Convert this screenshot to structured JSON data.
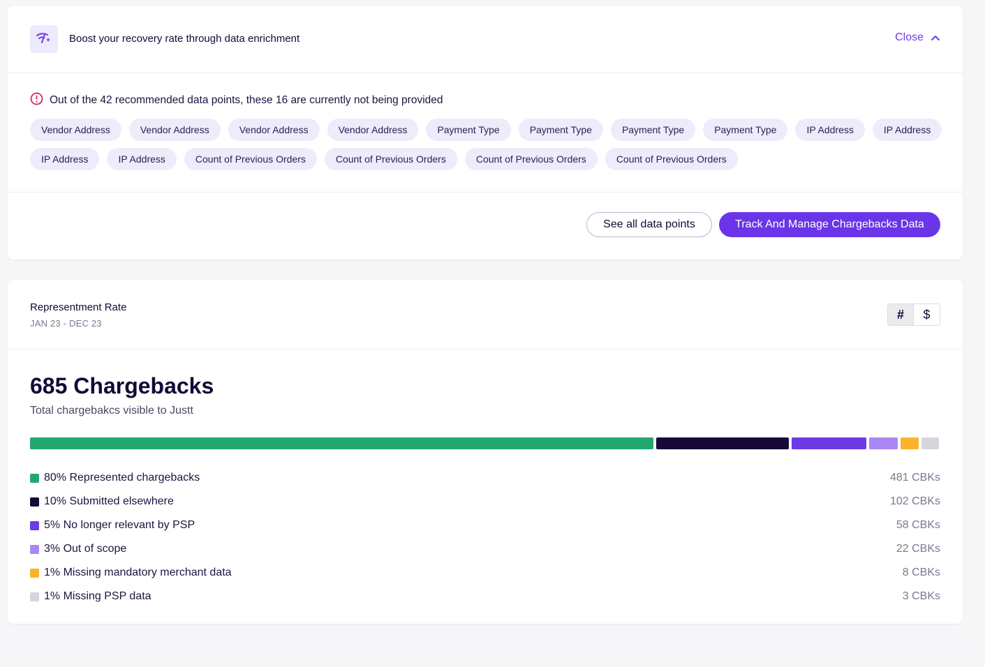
{
  "enrichment": {
    "title": "Boost your recovery rate through data enrichment",
    "close_label": "Close",
    "alert_text": "Out of the 42 recommended data points, these 16 are currently not being provided",
    "chips": [
      "Vendor Address",
      "Vendor Address",
      "Vendor Address",
      "Vendor Address",
      "Payment Type",
      "Payment Type",
      "Payment Type",
      "Payment Type",
      "IP Address",
      "IP Address",
      "IP Address",
      "IP Address",
      "Count of Previous Orders",
      "Count of Previous Orders",
      "Count of Previous Orders",
      "Count of Previous Orders"
    ],
    "see_all_label": "See all data points",
    "track_label": "Track And Manage Chargebacks Data"
  },
  "rate": {
    "title": "Representment Rate",
    "period": "JAN 23 - DEC 23",
    "toggle": {
      "count_label": "#",
      "amount_label": "$",
      "active": "count"
    },
    "total_label": "685 Chargebacks",
    "total_sub": "Total chargebakcs visible to Justt",
    "breakdown": [
      {
        "label": "80% Represented chargebacks",
        "count": "481 CBKs",
        "value": 481,
        "color": "#22a86e"
      },
      {
        "label": "10% Submitted elsewhere",
        "count": "102 CBKs",
        "value": 102,
        "color": "#16093a"
      },
      {
        "label": "5% No longer relevant by PSP",
        "count": "58 CBKs",
        "value": 58,
        "color": "#6d3be3"
      },
      {
        "label": "3% Out of scope",
        "count": "22 CBKs",
        "value": 22,
        "color": "#a987f5"
      },
      {
        "label": "1% Missing mandatory merchant data",
        "count": "8 CBKs",
        "value": 8,
        "color": "#fbb32c"
      },
      {
        "label": "1% Missing PSP data",
        "count": "3 CBKs",
        "value": 3,
        "color": "#d6d5db"
      }
    ]
  },
  "colors": {
    "accent": "#6a35e8",
    "chip_bg": "#eeebfb",
    "alert": "#e0245e"
  },
  "icons": {
    "enrich": "signal-sparkle-icon",
    "close": "chevron-up-icon",
    "alert": "alert-circle-icon"
  }
}
